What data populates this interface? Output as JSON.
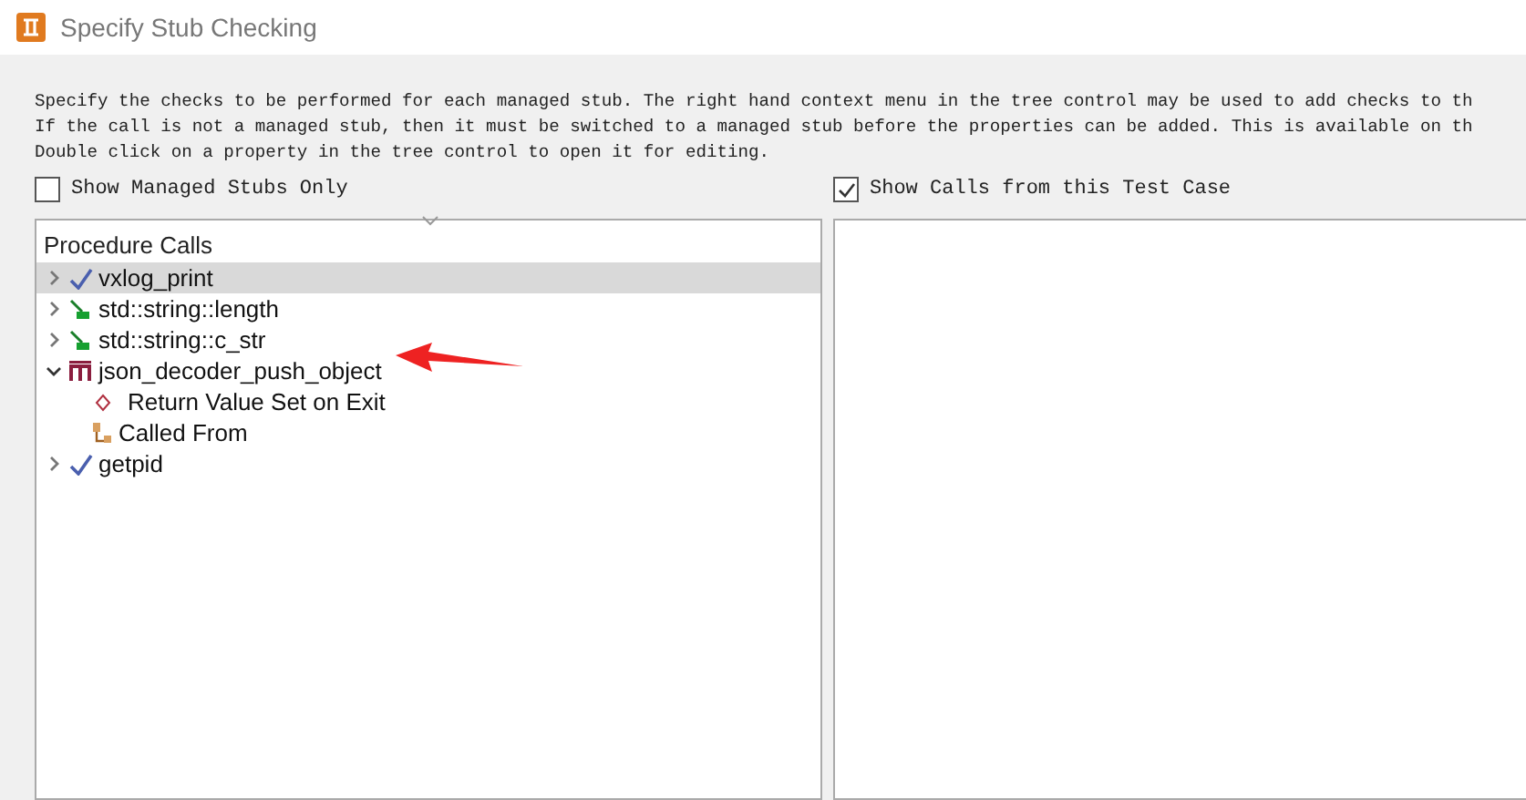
{
  "window": {
    "title": "Specify Stub Checking"
  },
  "description": [
    "Specify the checks to be performed for each managed stub. The right hand context menu in the tree control may be used to add checks to th",
    "If the call is not a managed stub, then it must be switched to a managed stub before the properties can be added. This is available on th",
    "Double click on a property in the tree control to open it for editing."
  ],
  "options": [
    {
      "label": "Show Managed Stubs Only",
      "checked": false
    },
    {
      "label": "Show Calls from this Test Case",
      "checked": true
    }
  ],
  "tree": {
    "header": "Procedure Calls",
    "items": [
      {
        "label": "vxlog_print",
        "kind": "check",
        "selected": true,
        "expanded": false
      },
      {
        "label": "std::string::length",
        "kind": "stub",
        "selected": false,
        "expanded": false
      },
      {
        "label": "std::string::c_str",
        "kind": "stub",
        "selected": false,
        "expanded": false
      },
      {
        "label": "json_decoder_push_object",
        "kind": "managed",
        "selected": false,
        "expanded": true,
        "annotated": true,
        "children": [
          {
            "label": "Return Value Set on Exit",
            "kind": "value"
          },
          {
            "label": "Called From",
            "kind": "caller"
          }
        ]
      },
      {
        "label": "getpid",
        "kind": "check",
        "selected": false,
        "expanded": false
      }
    ]
  }
}
